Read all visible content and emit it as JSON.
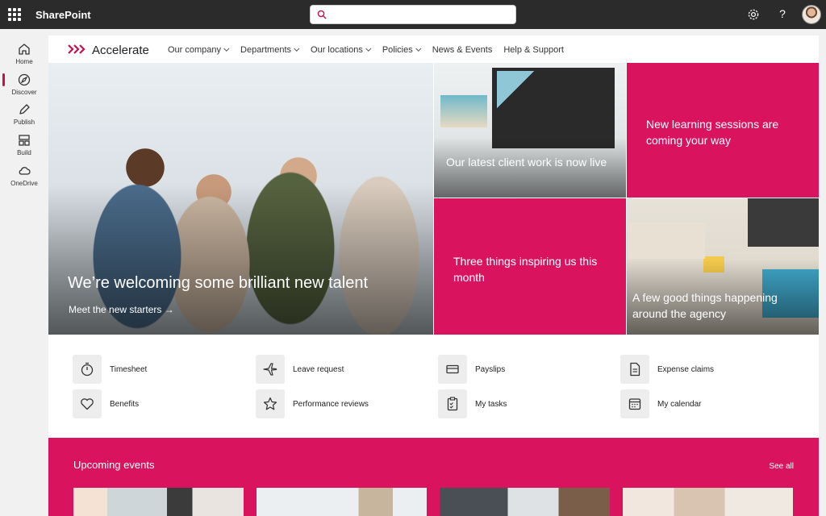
{
  "suite": {
    "app_name": "SharePoint",
    "search_placeholder": "",
    "help_glyph": "?"
  },
  "appbar": [
    {
      "label": "Home",
      "icon": "home-icon",
      "active": true
    },
    {
      "label": "Discover",
      "icon": "compass-icon"
    },
    {
      "label": "Publish",
      "icon": "pen-icon"
    },
    {
      "label": "Build",
      "icon": "layout-icon"
    },
    {
      "label": "OneDrive",
      "icon": "cloud-icon"
    }
  ],
  "site": {
    "name": "Accelerate",
    "nav": [
      {
        "label": "Our company",
        "dropdown": true
      },
      {
        "label": "Departments",
        "dropdown": true
      },
      {
        "label": "Our locations",
        "dropdown": true
      },
      {
        "label": "Policies",
        "dropdown": true
      },
      {
        "label": "News & Events",
        "dropdown": false
      },
      {
        "label": "Help & Support",
        "dropdown": false
      }
    ]
  },
  "hero": {
    "main_title": "We’re welcoming some brilliant new talent",
    "main_link": "Meet the new starters →",
    "tile1": "Our latest client work is now live",
    "tile2": "New learning sessions are coming your way",
    "tile3": "Three things inspiring us this month",
    "tile4": "A few good things happening around the agency"
  },
  "quick_links": [
    {
      "label": "Timesheet",
      "icon": "stopwatch-icon"
    },
    {
      "label": "Leave request",
      "icon": "airplane-icon"
    },
    {
      "label": "Payslips",
      "icon": "card-icon"
    },
    {
      "label": "Expense claims",
      "icon": "document-icon"
    },
    {
      "label": "Benefits",
      "icon": "heart-icon"
    },
    {
      "label": "Performance reviews",
      "icon": "star-icon"
    },
    {
      "label": "My tasks",
      "icon": "checklist-icon"
    },
    {
      "label": "My calendar",
      "icon": "calendar-icon"
    }
  ],
  "events": {
    "title": "Upcoming events",
    "see_all": "See all"
  },
  "colors": {
    "accent": "#d9135e",
    "suitebar": "#2b2b2b"
  }
}
